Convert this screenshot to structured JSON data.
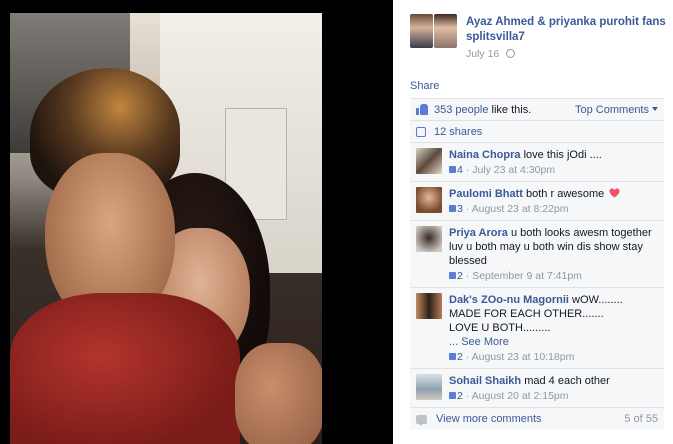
{
  "post": {
    "page_name": "Ayaz Ahmed & priyanka purohit fans splitsvilla7",
    "date": "July 16"
  },
  "actions": {
    "share": "Share"
  },
  "ufi": {
    "likes_count": "353 people",
    "likes_suffix": " like this.",
    "top_comments": "Top Comments",
    "shares": "12 shares"
  },
  "comments": [
    {
      "name": "Naina Chopra",
      "text": "love this jOdi ....",
      "likes": "4",
      "time": "July 23 at 4:30pm"
    },
    {
      "name": "Paulomi Bhatt",
      "text": "both r awesome",
      "likes": "3",
      "time": "August 23 at 8:22pm"
    },
    {
      "name": "Priya Arora",
      "text": "u both looks awesm together luv u both may u both win dis show stay blessed",
      "likes": "2",
      "time": "September 9 at 7:41pm"
    },
    {
      "name": "Dak's ZOo-nu Magornii",
      "text": "wOW........",
      "text2": "MADE FOR EACH OTHER.......",
      "text3": "LOVE U BOTH.........",
      "see_more": "... See More",
      "likes": "2",
      "time": "August 23 at 10:18pm"
    },
    {
      "name": "Sohail Shaikh",
      "text": "mad 4 each other",
      "likes": "2",
      "time": "August 20 at 2:15pm"
    }
  ],
  "footer": {
    "view_more": "View more comments",
    "paging": "5 of 55"
  },
  "colors": {
    "link": "#3b5998",
    "meta": "#9197a3",
    "ufi_bg": "#f6f7f8",
    "heart": "#f25268"
  },
  "icons": [
    "like-icon",
    "share-icon",
    "globe-icon",
    "heart-icon",
    "comment-icon",
    "caret-down-icon"
  ]
}
